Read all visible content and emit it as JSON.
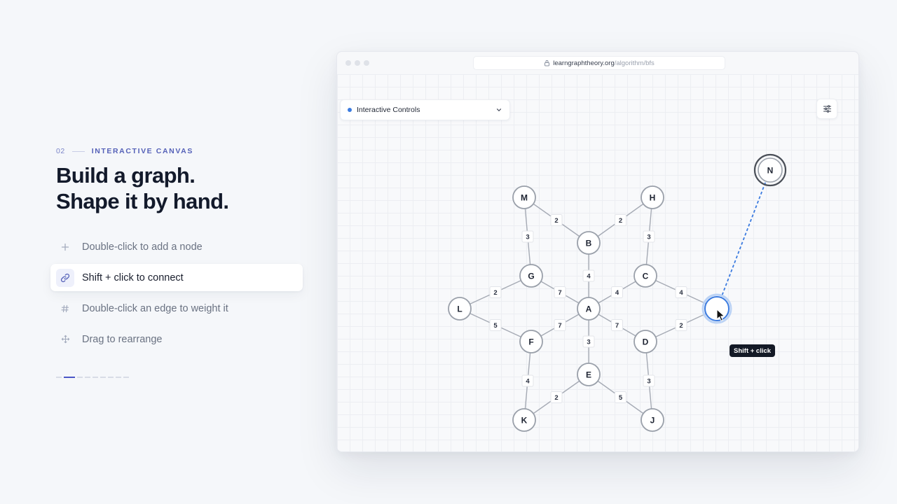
{
  "section": {
    "number": "02",
    "label": "INTERACTIVE CANVAS"
  },
  "headline": {
    "line1": "Build a graph.",
    "line2": "Shape it by hand."
  },
  "features": [
    {
      "icon": "plus-icon",
      "label": "Double-click to add a node",
      "active": false
    },
    {
      "icon": "link-icon",
      "label": "Shift + click to connect",
      "active": true
    },
    {
      "icon": "hash-icon",
      "label": "Double-click an edge to weight it",
      "active": false
    },
    {
      "icon": "move-icon",
      "label": "Drag to rearrange",
      "active": false
    }
  ],
  "progress": {
    "total": 9,
    "current": 2
  },
  "browser": {
    "domain": "learngraphtheory.org",
    "path": "/algorithm/bfs"
  },
  "controls": {
    "dropdown_label": "Interactive Controls"
  },
  "graph": {
    "nodes": [
      {
        "id": "M",
        "label": "M"
      },
      {
        "id": "H",
        "label": "H"
      },
      {
        "id": "B",
        "label": "B"
      },
      {
        "id": "G",
        "label": "G"
      },
      {
        "id": "C",
        "label": "C"
      },
      {
        "id": "L",
        "label": "L"
      },
      {
        "id": "A",
        "label": "A"
      },
      {
        "id": "I",
        "label": "",
        "state": "selected"
      },
      {
        "id": "F",
        "label": "F"
      },
      {
        "id": "D",
        "label": "D"
      },
      {
        "id": "E",
        "label": "E"
      },
      {
        "id": "K",
        "label": "K"
      },
      {
        "id": "J",
        "label": "J"
      },
      {
        "id": "N",
        "label": "N",
        "state": "target"
      }
    ],
    "edges": [
      {
        "from": "M",
        "to": "B",
        "weight": "2"
      },
      {
        "from": "M",
        "to": "G",
        "weight": "3"
      },
      {
        "from": "H",
        "to": "B",
        "weight": "2"
      },
      {
        "from": "H",
        "to": "C",
        "weight": "3"
      },
      {
        "from": "B",
        "to": "A",
        "weight": "4"
      },
      {
        "from": "G",
        "to": "A",
        "weight": "7"
      },
      {
        "from": "G",
        "to": "L",
        "weight": "2"
      },
      {
        "from": "C",
        "to": "A",
        "weight": "4"
      },
      {
        "from": "C",
        "to": "I",
        "weight": "4"
      },
      {
        "from": "L",
        "to": "F",
        "weight": "5"
      },
      {
        "from": "A",
        "to": "F",
        "weight": "7"
      },
      {
        "from": "A",
        "to": "D",
        "weight": "7"
      },
      {
        "from": "A",
        "to": "E",
        "weight": "3"
      },
      {
        "from": "D",
        "to": "I",
        "weight": "2"
      },
      {
        "from": "D",
        "to": "J",
        "weight": "3"
      },
      {
        "from": "F",
        "to": "K",
        "weight": "4"
      },
      {
        "from": "E",
        "to": "K",
        "weight": "2"
      },
      {
        "from": "E",
        "to": "J",
        "weight": "5"
      }
    ],
    "pending_connection": {
      "from": "I",
      "to": "N"
    }
  },
  "tooltip": "Shift + click",
  "colors": {
    "accent": "#4a56c6",
    "selection": "#3b7be0",
    "node_stroke": "#9aa0aa",
    "edge": "#a5aab4"
  }
}
